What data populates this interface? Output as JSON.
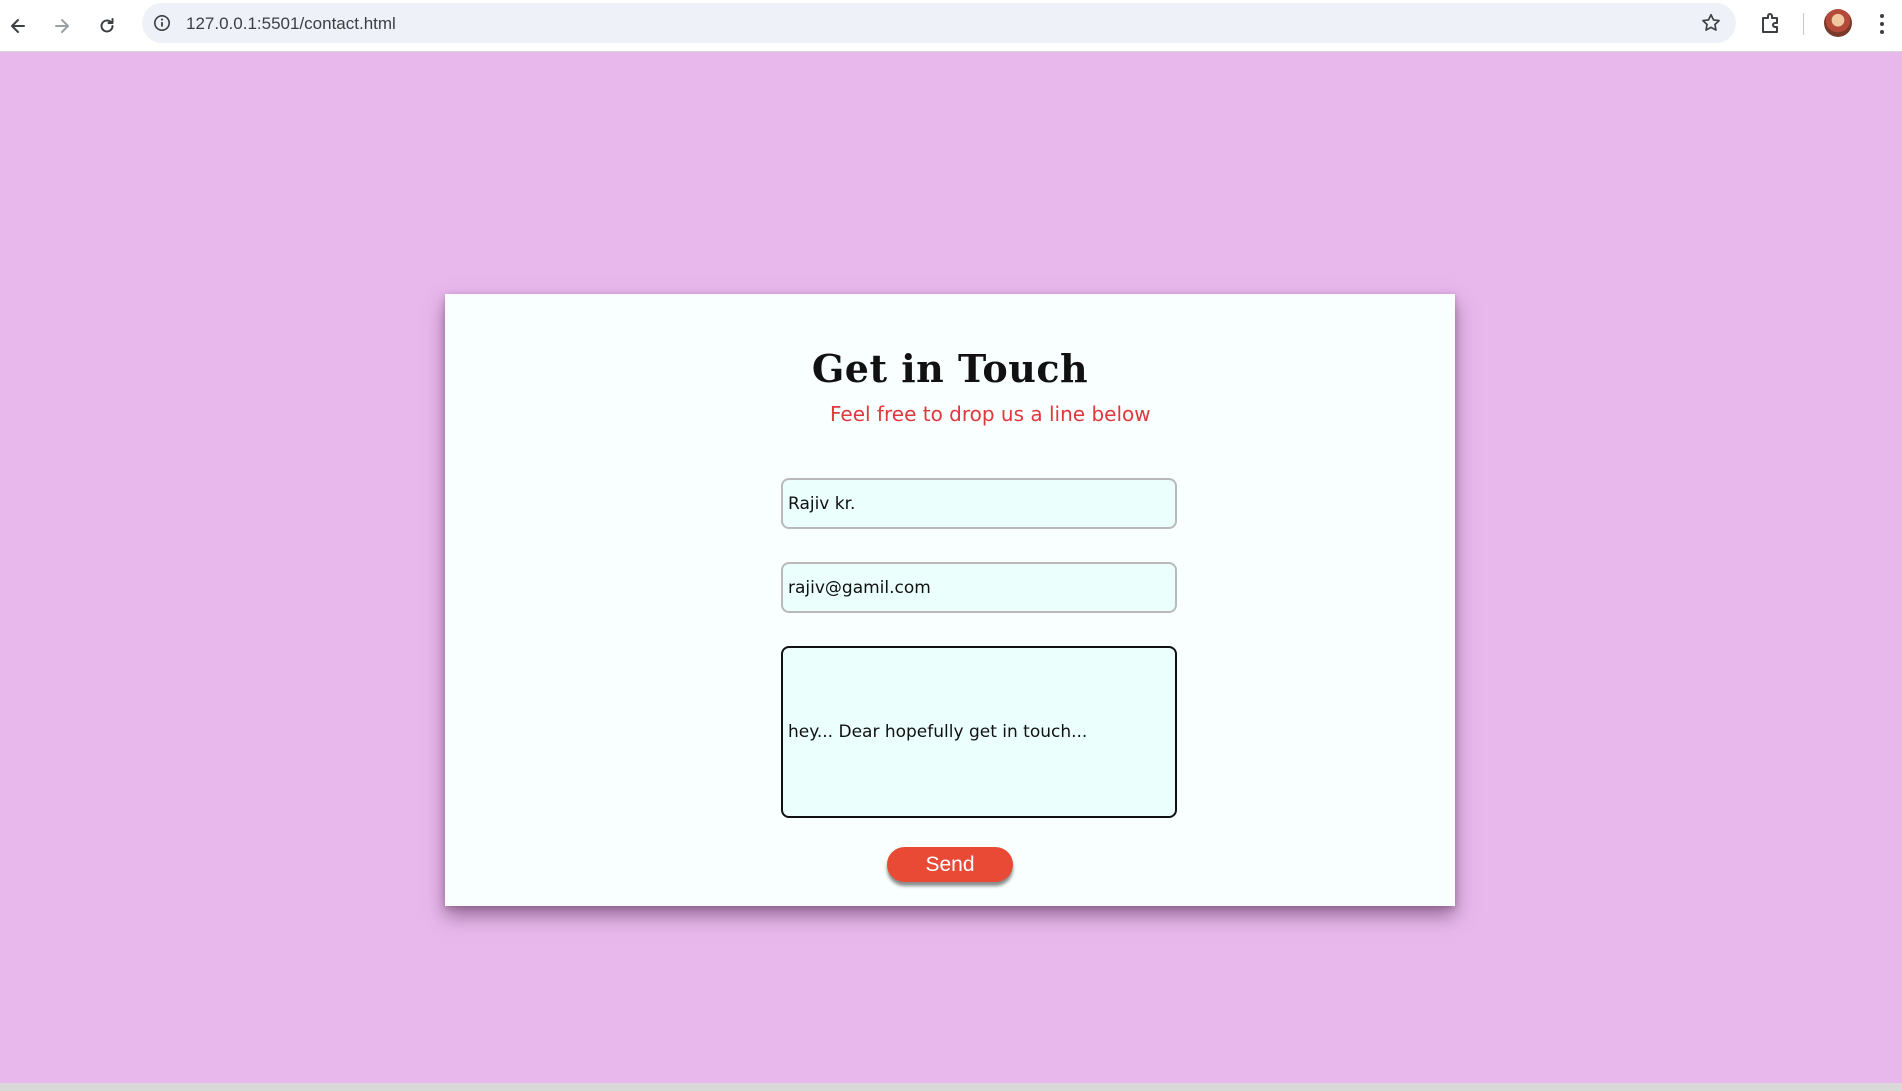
{
  "browser": {
    "url": "127.0.0.1:5501/contact.html",
    "icons": [
      "back-arrow-icon",
      "forward-arrow-icon",
      "reload-icon",
      "info-icon",
      "star-icon",
      "extensions-icon",
      "profile-avatar",
      "kebab-menu-icon"
    ]
  },
  "contact": {
    "title": "Get in Touch",
    "subtitle": "Feel free to drop us a line below",
    "name_value": "Rajiv kr.",
    "email_value": "rajiv@gamil.com",
    "message_value": "hey... Dear hopefully get in touch...",
    "send_label": "Send"
  },
  "colors": {
    "page_background": "#e8b8ec",
    "card_background": "#f8fffe",
    "subtitle": "#e0383c",
    "field_background": "#ebfffd",
    "send_button": "#e84a35"
  }
}
